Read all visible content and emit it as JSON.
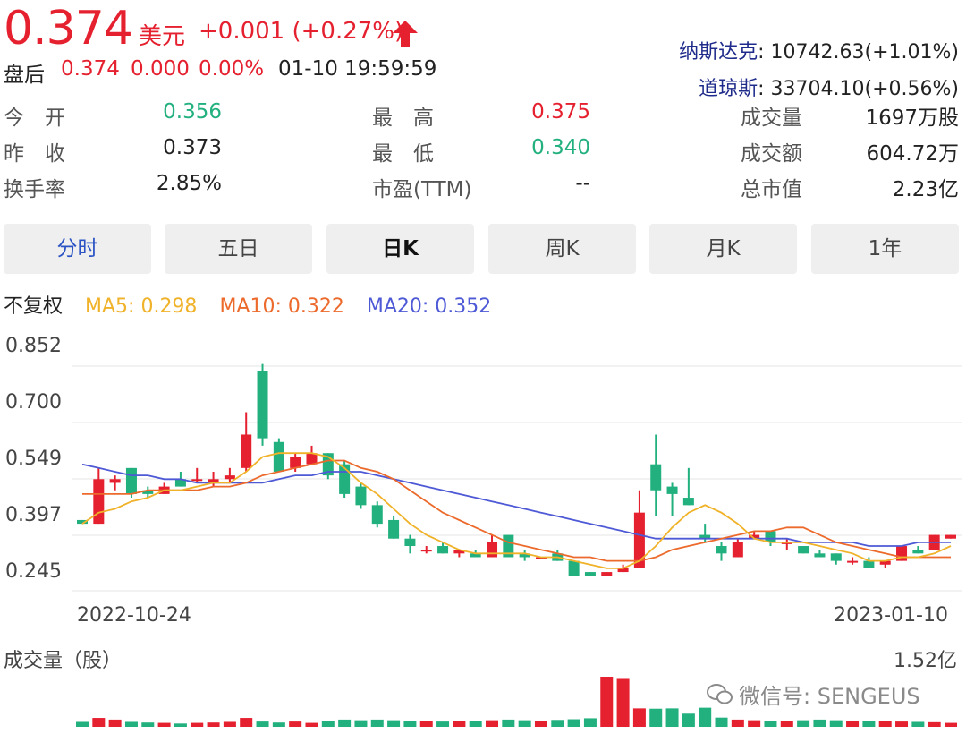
{
  "quote": {
    "price": "0.374",
    "currency": "美元",
    "change": "+0.001 (+0.27%)",
    "after_hours_label": "盘后",
    "after_hours_price": "0.374",
    "after_hours_change": "0.000",
    "after_hours_pct": "0.00%",
    "after_hours_time": "01-10 19:59:59"
  },
  "indices": [
    {
      "name": "纳斯达克",
      "value": ": 10742.63(+1.01%)"
    },
    {
      "name": "道琼斯",
      "value": ": 33704.10(+0.56%)"
    }
  ],
  "stats": [
    {
      "label": "今　开",
      "value": "0.356",
      "color": "#22b07e"
    },
    {
      "label": "最　高",
      "value": "0.375",
      "color": "#e5202f"
    },
    {
      "label": "成交量",
      "value": "1697万股",
      "color": "#222222"
    },
    {
      "label": "昨　收",
      "value": "0.373",
      "color": "#222222"
    },
    {
      "label": "最　低",
      "value": "0.340",
      "color": "#22b07e"
    },
    {
      "label": "成交额",
      "value": "604.72万",
      "color": "#222222"
    },
    {
      "label": "换手率",
      "value": "2.85%",
      "color": "#222222"
    },
    {
      "label": "市盈(TTM)",
      "value": "--",
      "color": "#222222"
    },
    {
      "label": "总市值",
      "value": "2.23亿",
      "color": "#222222"
    }
  ],
  "tabs": [
    "分时",
    "五日",
    "日K",
    "周K",
    "月K",
    "1年"
  ],
  "ma": {
    "adjust": "不复权",
    "ma5": "MA5: 0.298",
    "ma10": "MA10: 0.322",
    "ma20": "MA20: 0.352"
  },
  "colors": {
    "up": "#e5202f",
    "down": "#22b07e",
    "ma5": "#f0b229",
    "ma10": "#ec6a2c",
    "ma20": "#4e59d6"
  },
  "chart_data": {
    "type": "candlestick",
    "y_ticks": [
      "0.852",
      "0.700",
      "0.549",
      "0.397",
      "0.245"
    ],
    "ylim": [
      0.245,
      0.852
    ],
    "x_labels": [
      "2022-10-24",
      "2023-01-10"
    ],
    "candles": [
      {
        "o": 0.38,
        "c": 0.37,
        "h": 0.38,
        "l": 0.37
      },
      {
        "o": 0.37,
        "c": 0.49,
        "h": 0.52,
        "l": 0.37
      },
      {
        "o": 0.48,
        "c": 0.49,
        "h": 0.5,
        "l": 0.46
      },
      {
        "o": 0.52,
        "c": 0.45,
        "h": 0.52,
        "l": 0.44
      },
      {
        "o": 0.46,
        "c": 0.45,
        "h": 0.47,
        "l": 0.44
      },
      {
        "o": 0.45,
        "c": 0.47,
        "h": 0.48,
        "l": 0.45
      },
      {
        "o": 0.49,
        "c": 0.47,
        "h": 0.51,
        "l": 0.47
      },
      {
        "o": 0.49,
        "c": 0.49,
        "h": 0.52,
        "l": 0.48
      },
      {
        "o": 0.48,
        "c": 0.49,
        "h": 0.51,
        "l": 0.47
      },
      {
        "o": 0.49,
        "c": 0.5,
        "h": 0.52,
        "l": 0.48
      },
      {
        "o": 0.52,
        "c": 0.61,
        "h": 0.67,
        "l": 0.51
      },
      {
        "o": 0.78,
        "c": 0.6,
        "h": 0.8,
        "l": 0.58
      },
      {
        "o": 0.59,
        "c": 0.51,
        "h": 0.6,
        "l": 0.51
      },
      {
        "o": 0.52,
        "c": 0.55,
        "h": 0.56,
        "l": 0.51
      },
      {
        "o": 0.53,
        "c": 0.56,
        "h": 0.58,
        "l": 0.53
      },
      {
        "o": 0.56,
        "c": 0.5,
        "h": 0.56,
        "l": 0.49
      },
      {
        "o": 0.53,
        "c": 0.45,
        "h": 0.54,
        "l": 0.44
      },
      {
        "o": 0.47,
        "c": 0.42,
        "h": 0.48,
        "l": 0.41
      },
      {
        "o": 0.42,
        "c": 0.37,
        "h": 0.43,
        "l": 0.36
      },
      {
        "o": 0.38,
        "c": 0.33,
        "h": 0.39,
        "l": 0.33
      },
      {
        "o": 0.33,
        "c": 0.31,
        "h": 0.34,
        "l": 0.29
      },
      {
        "o": 0.3,
        "c": 0.3,
        "h": 0.31,
        "l": 0.29
      },
      {
        "o": 0.31,
        "c": 0.29,
        "h": 0.32,
        "l": 0.29
      },
      {
        "o": 0.29,
        "c": 0.3,
        "h": 0.3,
        "l": 0.28
      },
      {
        "o": 0.29,
        "c": 0.28,
        "h": 0.3,
        "l": 0.28
      },
      {
        "o": 0.28,
        "c": 0.32,
        "h": 0.34,
        "l": 0.28
      },
      {
        "o": 0.34,
        "c": 0.28,
        "h": 0.34,
        "l": 0.28
      },
      {
        "o": 0.29,
        "c": 0.28,
        "h": 0.3,
        "l": 0.27
      },
      {
        "o": 0.28,
        "c": 0.28,
        "h": 0.28,
        "l": 0.28
      },
      {
        "o": 0.29,
        "c": 0.27,
        "h": 0.3,
        "l": 0.27
      },
      {
        "o": 0.27,
        "c": 0.23,
        "h": 0.27,
        "l": 0.23
      },
      {
        "o": 0.24,
        "c": 0.23,
        "h": 0.24,
        "l": 0.23
      },
      {
        "o": 0.23,
        "c": 0.24,
        "h": 0.24,
        "l": 0.23
      },
      {
        "o": 0.24,
        "c": 0.25,
        "h": 0.26,
        "l": 0.24
      },
      {
        "o": 0.25,
        "c": 0.4,
        "h": 0.46,
        "l": 0.25
      },
      {
        "o": 0.53,
        "c": 0.46,
        "h": 0.61,
        "l": 0.39
      },
      {
        "o": 0.47,
        "c": 0.45,
        "h": 0.48,
        "l": 0.39
      },
      {
        "o": 0.44,
        "c": 0.42,
        "h": 0.52,
        "l": 0.42
      },
      {
        "o": 0.34,
        "c": 0.33,
        "h": 0.37,
        "l": 0.32
      },
      {
        "o": 0.31,
        "c": 0.29,
        "h": 0.32,
        "l": 0.27
      },
      {
        "o": 0.28,
        "c": 0.32,
        "h": 0.33,
        "l": 0.28
      },
      {
        "o": 0.33,
        "c": 0.34,
        "h": 0.35,
        "l": 0.33
      },
      {
        "o": 0.35,
        "c": 0.32,
        "h": 0.35,
        "l": 0.31
      },
      {
        "o": 0.32,
        "c": 0.32,
        "h": 0.33,
        "l": 0.3
      },
      {
        "o": 0.31,
        "c": 0.29,
        "h": 0.31,
        "l": 0.29
      },
      {
        "o": 0.29,
        "c": 0.28,
        "h": 0.3,
        "l": 0.28
      },
      {
        "o": 0.29,
        "c": 0.27,
        "h": 0.29,
        "l": 0.26
      },
      {
        "o": 0.27,
        "c": 0.27,
        "h": 0.28,
        "l": 0.26
      },
      {
        "o": 0.27,
        "c": 0.25,
        "h": 0.28,
        "l": 0.25
      },
      {
        "o": 0.26,
        "c": 0.27,
        "h": 0.27,
        "l": 0.25
      },
      {
        "o": 0.27,
        "c": 0.31,
        "h": 0.31,
        "l": 0.27
      },
      {
        "o": 0.3,
        "c": 0.29,
        "h": 0.31,
        "l": 0.29
      },
      {
        "o": 0.3,
        "c": 0.34,
        "h": 0.34,
        "l": 0.3
      },
      {
        "o": 0.33,
        "c": 0.34,
        "h": 0.34,
        "l": 0.33
      }
    ],
    "ma5": [
      0.37,
      0.4,
      0.41,
      0.43,
      0.44,
      0.46,
      0.46,
      0.47,
      0.48,
      0.48,
      0.51,
      0.55,
      0.56,
      0.56,
      0.56,
      0.55,
      0.52,
      0.48,
      0.45,
      0.41,
      0.37,
      0.34,
      0.32,
      0.3,
      0.29,
      0.29,
      0.29,
      0.29,
      0.28,
      0.28,
      0.27,
      0.26,
      0.25,
      0.25,
      0.27,
      0.31,
      0.36,
      0.4,
      0.42,
      0.4,
      0.37,
      0.33,
      0.32,
      0.32,
      0.32,
      0.31,
      0.3,
      0.29,
      0.27,
      0.27,
      0.28,
      0.28,
      0.29,
      0.31
    ],
    "ma10": [
      0.45,
      0.45,
      0.45,
      0.45,
      0.46,
      0.46,
      0.46,
      0.46,
      0.47,
      0.47,
      0.48,
      0.5,
      0.51,
      0.52,
      0.53,
      0.54,
      0.54,
      0.52,
      0.51,
      0.49,
      0.46,
      0.43,
      0.4,
      0.38,
      0.36,
      0.34,
      0.32,
      0.31,
      0.3,
      0.29,
      0.28,
      0.28,
      0.27,
      0.27,
      0.27,
      0.28,
      0.3,
      0.31,
      0.32,
      0.33,
      0.34,
      0.35,
      0.35,
      0.36,
      0.36,
      0.34,
      0.32,
      0.31,
      0.3,
      0.29,
      0.28,
      0.28,
      0.28,
      0.28
    ],
    "ma20": [
      0.53,
      0.52,
      0.51,
      0.5,
      0.5,
      0.49,
      0.49,
      0.48,
      0.48,
      0.48,
      0.48,
      0.48,
      0.49,
      0.5,
      0.5,
      0.51,
      0.51,
      0.51,
      0.5,
      0.49,
      0.48,
      0.47,
      0.46,
      0.45,
      0.44,
      0.43,
      0.42,
      0.41,
      0.4,
      0.39,
      0.38,
      0.37,
      0.36,
      0.35,
      0.34,
      0.33,
      0.33,
      0.33,
      0.33,
      0.33,
      0.33,
      0.33,
      0.33,
      0.33,
      0.32,
      0.32,
      0.32,
      0.32,
      0.31,
      0.31,
      0.31,
      0.32,
      0.32,
      0.32
    ],
    "volume_label": "成交量（股）",
    "volume_max_label": "1.52亿",
    "volume_max": 1.52,
    "volumes": [
      0.15,
      0.27,
      0.22,
      0.15,
      0.13,
      0.12,
      0.1,
      0.12,
      0.13,
      0.15,
      0.27,
      0.16,
      0.13,
      0.16,
      0.12,
      0.18,
      0.22,
      0.2,
      0.22,
      0.2,
      0.19,
      0.18,
      0.16,
      0.17,
      0.18,
      0.2,
      0.22,
      0.2,
      0.18,
      0.21,
      0.23,
      0.26,
      1.52,
      1.48,
      0.56,
      0.55,
      0.56,
      0.4,
      0.58,
      0.28,
      0.22,
      0.2,
      0.18,
      0.17,
      0.2,
      0.22,
      0.2,
      0.17,
      0.18,
      0.18,
      0.16,
      0.15,
      0.14,
      0.12
    ]
  },
  "watermark": "微信号: SENGEUS"
}
